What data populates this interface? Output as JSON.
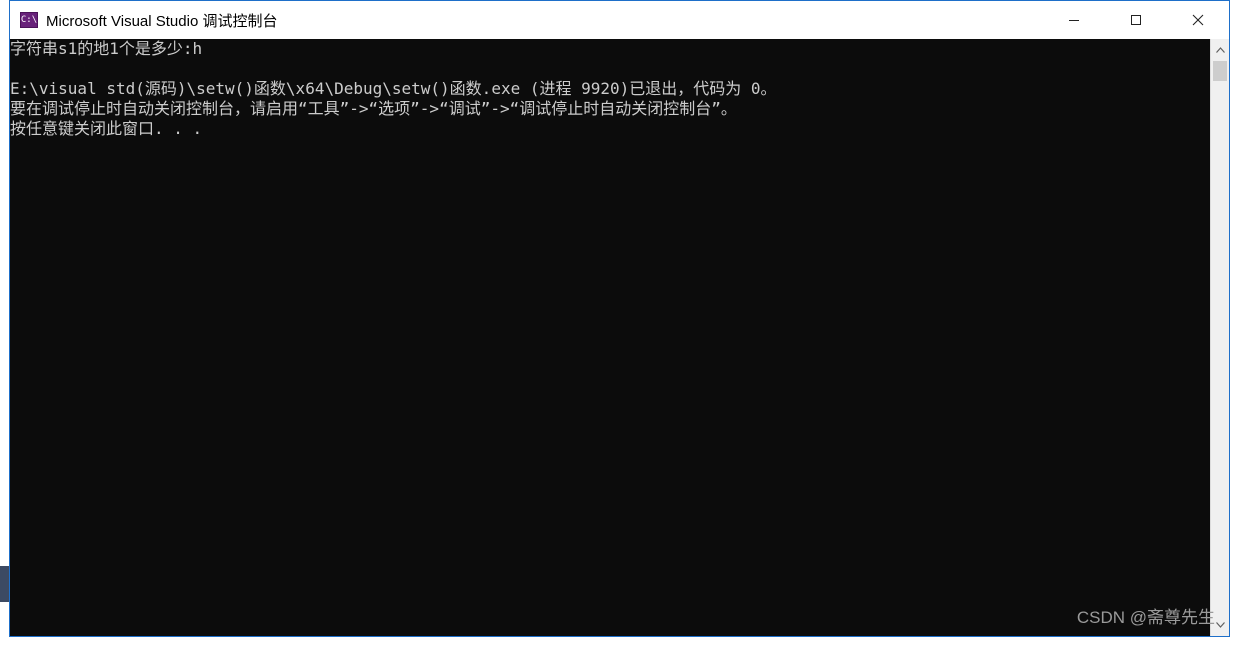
{
  "window": {
    "title": "Microsoft Visual Studio 调试控制台",
    "icon_label": "C:\\"
  },
  "console": {
    "lines": [
      "字符串s1的地1个是多少:h",
      "",
      "E:\\visual std(源码)\\setw()函数\\x64\\Debug\\setw()函数.exe (进程 9920)已退出，代码为 0。",
      "要在调试停止时自动关闭控制台，请启用“工具”->“选项”->“调试”->“调试停止时自动关闭控制台”。",
      "按任意键关闭此窗口. . ."
    ]
  },
  "watermark": "CSDN @斋尊先生",
  "colors": {
    "console_bg": "#0c0c0c",
    "console_text": "#cccccc",
    "title_bg": "#ffffff",
    "window_border": "#1e6fc9",
    "icon_bg": "#68217a"
  }
}
